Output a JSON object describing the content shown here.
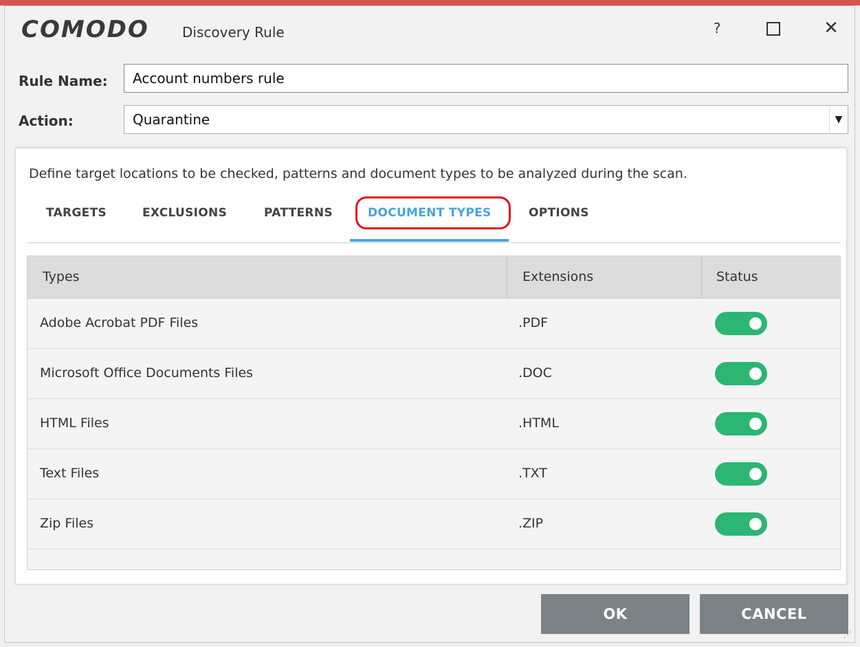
{
  "window": {
    "brand": "COMODO",
    "title": "Discovery Rule",
    "controls": {
      "help": "?",
      "maximize_icon": "maximize-icon",
      "close": "✕"
    }
  },
  "form": {
    "rule_name_label": "Rule Name:",
    "rule_name_value": "Account numbers rule",
    "action_label": "Action:",
    "action_value": "Quarantine"
  },
  "panel": {
    "description": "Define target locations to be checked, patterns and document types to be analyzed during the scan.",
    "tabs": [
      {
        "label": "TARGETS"
      },
      {
        "label": "EXCLUSIONS"
      },
      {
        "label": "PATTERNS"
      },
      {
        "label": "DOCUMENT TYPES",
        "active": true
      },
      {
        "label": "OPTIONS"
      }
    ]
  },
  "table": {
    "headers": {
      "types": "Types",
      "extensions": "Extensions",
      "status": "Status"
    },
    "rows": [
      {
        "type": "Adobe Acrobat PDF Files",
        "extension": ".PDF",
        "enabled": true
      },
      {
        "type": "Microsoft Office Documents Files",
        "extension": ".DOC",
        "enabled": true
      },
      {
        "type": "HTML Files",
        "extension": ".HTML",
        "enabled": true
      },
      {
        "type": "Text Files",
        "extension": ".TXT",
        "enabled": true
      },
      {
        "type": "Zip Files",
        "extension": ".ZIP",
        "enabled": true
      }
    ]
  },
  "buttons": {
    "ok": "OK",
    "cancel": "CANCEL"
  },
  "colors": {
    "accent_tab": "#4aa3df",
    "toggle_on": "#2bb673",
    "button_bg": "#7b8387",
    "highlight_ring": "#e0141e"
  }
}
